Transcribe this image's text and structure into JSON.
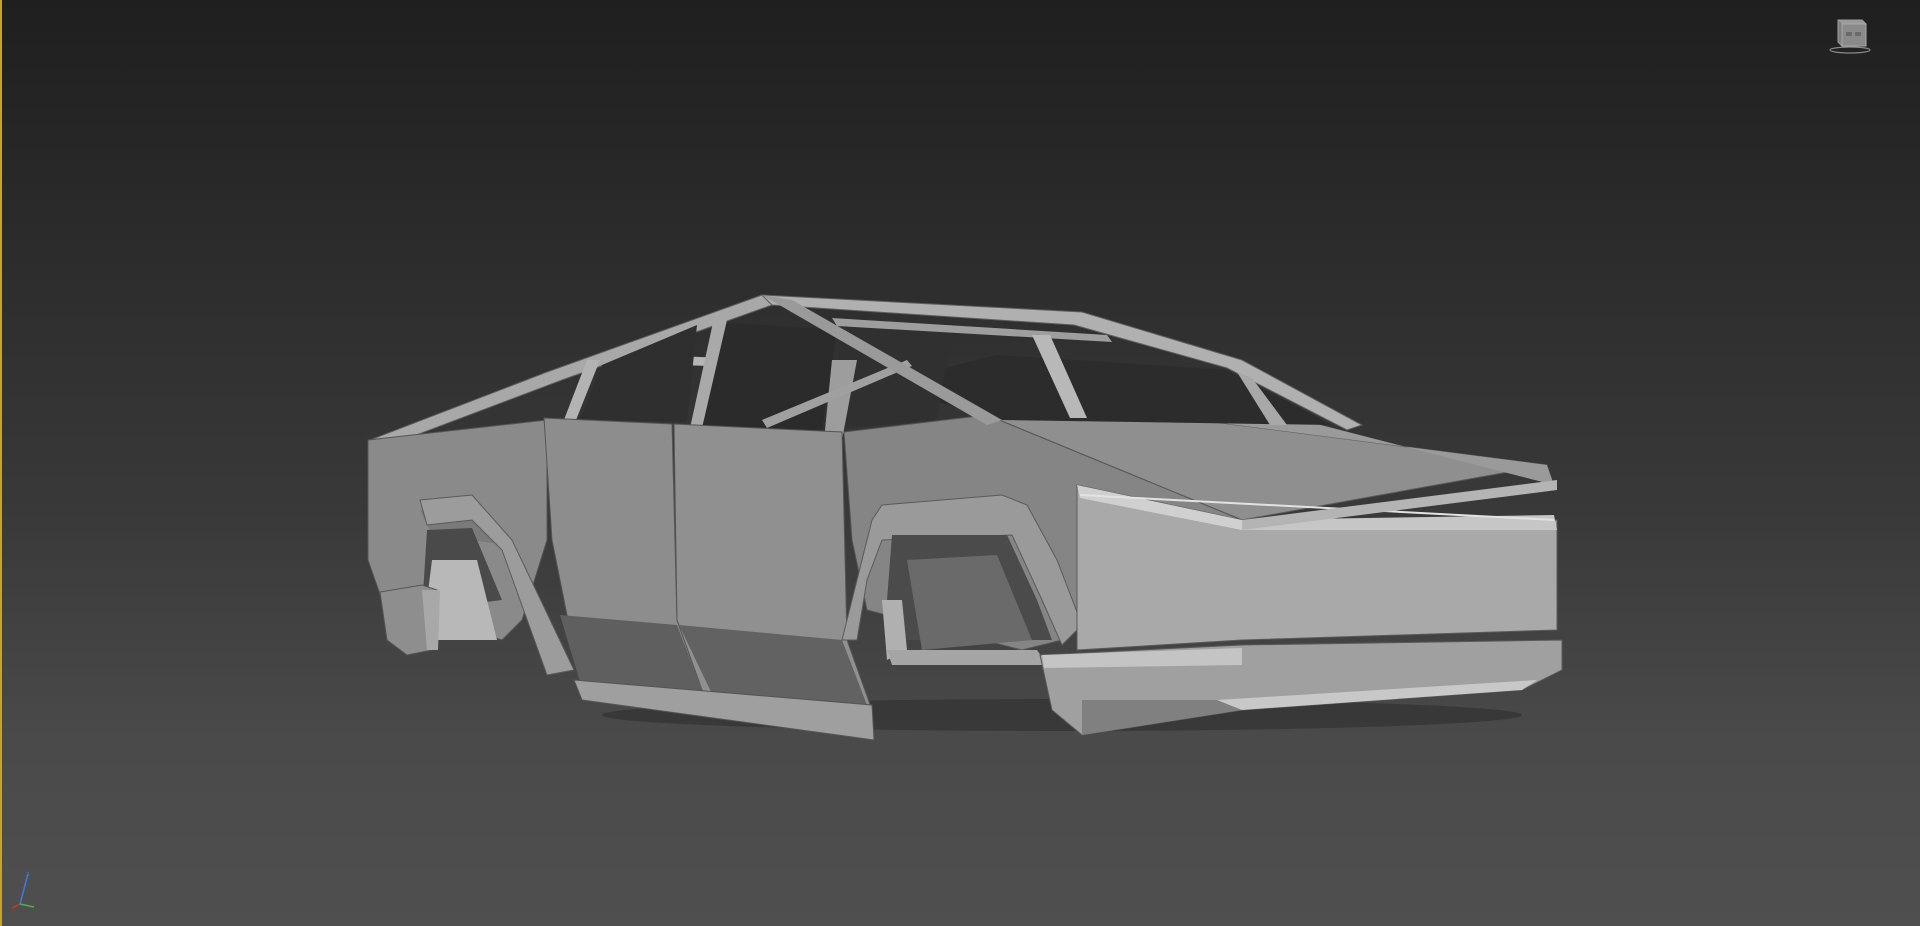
{
  "viewport": {
    "colors": {
      "border_active": "#c9a227",
      "background_top": "#1f1f1f",
      "background_bottom": "#4f4f4f",
      "model_base": "#8c8c8c"
    }
  },
  "viewcube": {
    "icon": "viewcube-icon"
  },
  "axis_tripod": {
    "icon": "axis-tripod-icon"
  },
  "model": {
    "icon": "car-body-model"
  }
}
